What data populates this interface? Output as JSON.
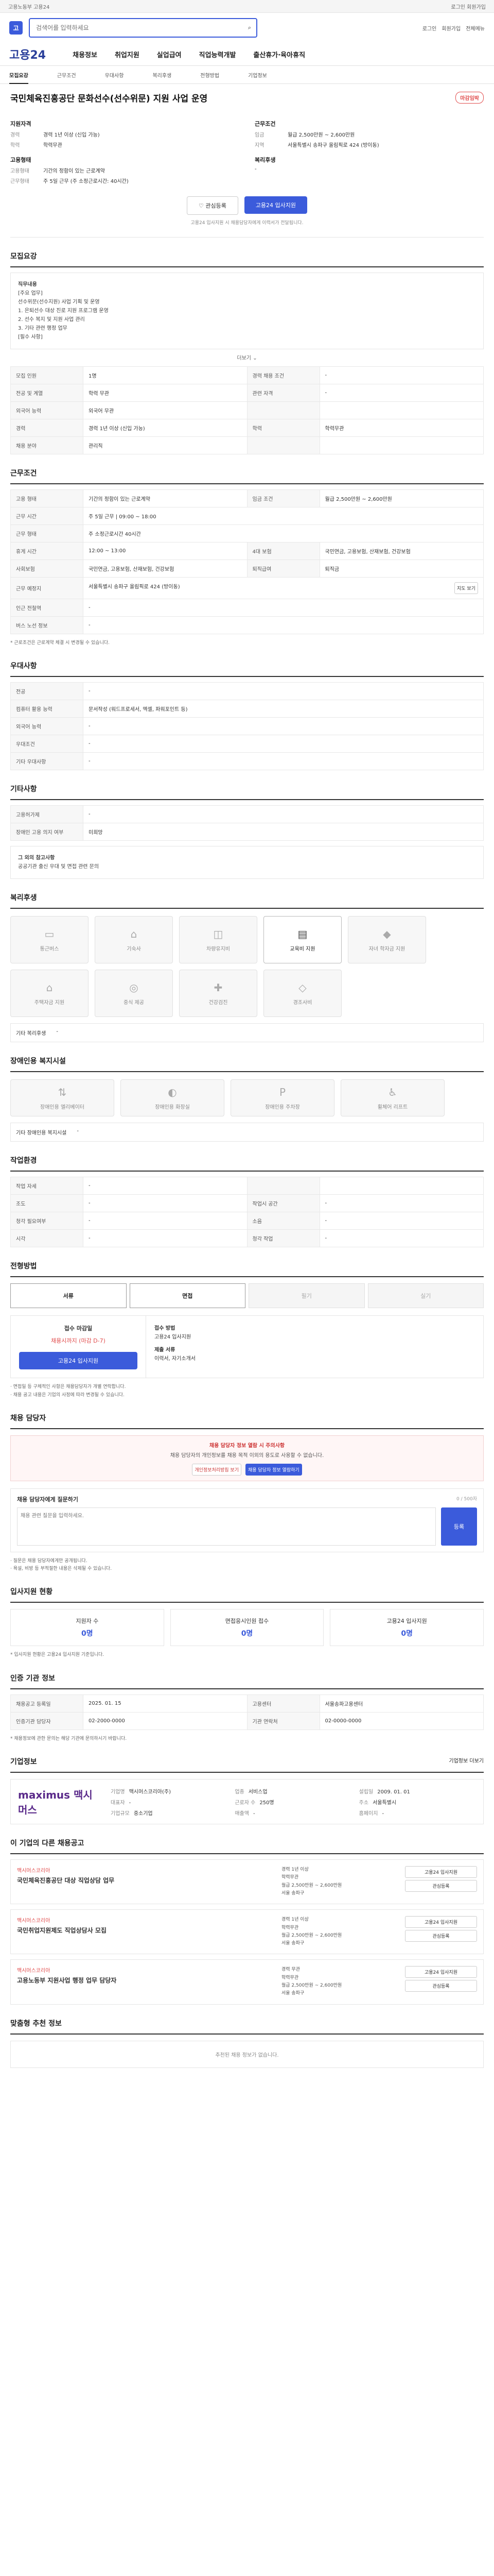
{
  "topbar": {
    "left": "고용노동부 고용24",
    "right": "로그인 회원가입"
  },
  "header": {
    "logo": "고",
    "search_placeholder": "검색어를 입력하세요",
    "util": [
      "로그인",
      "회원가입",
      "전체메뉴"
    ]
  },
  "brand": {
    "name": "고용24",
    "menu": [
      "채용정보",
      "취업지원",
      "실업급여",
      "직업능력개발",
      "출산휴가·육아휴직"
    ]
  },
  "subnav": [
    "모집요강",
    "근무조건",
    "우대사항",
    "복리후생",
    "전형방법",
    "기업정보"
  ],
  "job": {
    "title": "국민체육진흥공단 문화선수(선수위문) 지원 사업 운영",
    "badge": "마감임박",
    "left_head": "지원자격",
    "left": [
      {
        "k": "경력",
        "v": "경력 1년 이상 (신입 가능)"
      },
      {
        "k": "학력",
        "v": "학력무관"
      }
    ],
    "right_head": "근무조건",
    "right": [
      {
        "k": "임금",
        "v": "월급 2,500만원 ~ 2,600만원"
      },
      {
        "k": "지역",
        "v": "서울특별시 송파구 올림픽로 424 (방이동)"
      }
    ],
    "emp_head": "고용형태",
    "emp": [
      {
        "k": "고용형태",
        "v": "기간의 정함이 있는 근로계약"
      },
      {
        "k": "근무형태",
        "v": "주 5일 근무 (주 소정근로시간: 40시간)"
      }
    ],
    "welfare_head": "복리후생",
    "welfare": "-"
  },
  "actions": {
    "interest": "관심등록",
    "apply": "고용24 입사지원",
    "note": "고용24 입사지원 시 채용담당자에게 이력서가 전달됩니다."
  },
  "recruit": {
    "title": "모집요강",
    "box_title": "직무내용",
    "box_lines": [
      "[주요 업무]",
      "선수위문(선수지원) 사업 기획 및 운영",
      "1. 은퇴선수 대상 진로 지원 프로그램 운영",
      "2. 선수 복지 및 지원 사업 관리",
      "3. 기타 관련 행정 업무",
      "[필수 사항]"
    ],
    "expand": "더보기",
    "rows": [
      {
        "k": "모집 인원",
        "v": "1명",
        "k2": "경력 채용 조건",
        "v2": "-"
      },
      {
        "k": "전공 및 계열",
        "v": "학력 무관",
        "k2": "관련 자격",
        "v2": "-"
      },
      {
        "k": "외국어 능력",
        "v": "외국어 무관",
        "k2": "",
        "v2": ""
      },
      {
        "k": "경력",
        "v": "경력 1년 이상 (신입 가능)",
        "k2": "학력",
        "v2": "학력무관"
      },
      {
        "k": "채용 분야",
        "v": "관리직",
        "k2": "",
        "v2": ""
      }
    ]
  },
  "work": {
    "title": "근무조건",
    "rows": [
      {
        "k": "고용 형태",
        "v": "기간의 정함이 있는 근로계약",
        "k2": "임금 조건",
        "v2": "월급 2,500만원 ~ 2,600만원"
      },
      {
        "k": "근무 시간",
        "v": "주 5일 근무 | 09:00 ~ 18:00",
        "k2": "",
        "v2": ""
      },
      {
        "k": "근무 형태",
        "v": "주 소정근로시간 40시간",
        "k2": "",
        "v2": ""
      },
      {
        "k": "휴게 시간",
        "v": "12:00 ~ 13:00",
        "k2": "4대 보험",
        "v2": "국민연금, 고용보험, 산재보험, 건강보험"
      },
      {
        "k": "사회보험",
        "v": "국민연금, 고용보험, 산재보험, 건강보험",
        "k2": "퇴직급여",
        "v2": "퇴직금"
      },
      {
        "k": "근무 예정지",
        "v": "서울특별시 송파구 올림픽로 424 (방이동)",
        "k2": "",
        "v2": ""
      },
      {
        "k": "인근 전철역",
        "v": "-",
        "k2": "",
        "v2": ""
      },
      {
        "k": "버스 노선 정보",
        "v": "-",
        "k2": "",
        "v2": ""
      }
    ],
    "note": "* 근로조건은 근로계약 체결 시 변경될 수 있습니다."
  },
  "pref": {
    "title": "우대사항",
    "rows": [
      {
        "k": "전공",
        "v": "-"
      },
      {
        "k": "컴퓨터 활용 능력",
        "v": "문서작성 (워드프로세서, 엑셀, 파워포인트 등)"
      },
      {
        "k": "외국어 능력",
        "v": "-"
      },
      {
        "k": "우대조건",
        "v": "-"
      },
      {
        "k": "기타 우대사항",
        "v": "-"
      }
    ]
  },
  "other": {
    "title": "기타사항",
    "rows": [
      {
        "k": "고용허가제",
        "v": "-"
      },
      {
        "k": "장애인 고용 의지 여부",
        "v": "미희망"
      }
    ],
    "note_title": "그 외의 참고사항",
    "note_text": "공공기관 출신 우대 및 면접 관련 문의"
  },
  "welfare": {
    "title": "복리후생",
    "tiles": [
      {
        "label": "통근버스",
        "on": false
      },
      {
        "label": "기숙사",
        "on": false
      },
      {
        "label": "차량유지비",
        "on": false
      },
      {
        "label": "교육비 지원",
        "on": true
      },
      {
        "label": "자녀 학자금 지원",
        "on": false
      },
      {
        "label": "주택자금 지원",
        "on": false
      },
      {
        "label": "중식 제공",
        "on": false
      },
      {
        "label": "건강검진",
        "on": false
      },
      {
        "label": "경조사비",
        "on": false
      }
    ],
    "etc_label": "기타 복리후생",
    "etc_value": "-"
  },
  "disabled_fac": {
    "title": "장애인용 복지시설",
    "tiles": [
      {
        "label": "장애인용 엘리베이터"
      },
      {
        "label": "장애인용 화장실"
      },
      {
        "label": "장애인용 주차장"
      },
      {
        "label": "휠체어 리프트"
      }
    ],
    "etc_label": "기타 장애인용 복지시설",
    "etc_value": "-"
  },
  "workplace": {
    "title": "작업환경",
    "rows": [
      {
        "k": "작업 자세",
        "v": "-",
        "k2": "",
        "v2": ""
      },
      {
        "k": "조도",
        "v": "-",
        "k2": "작업시 공간",
        "v2": "-"
      },
      {
        "k": "청각 필요여부",
        "v": "-",
        "k2": "소음",
        "v2": "-"
      },
      {
        "k": "시각",
        "v": "-",
        "k2": "청각 작업",
        "v2": "-"
      }
    ]
  },
  "process": {
    "title": "전형방법",
    "steps": [
      {
        "label": "서류",
        "on": true
      },
      {
        "label": "면접",
        "on": true
      },
      {
        "label": "필기",
        "on": false
      },
      {
        "label": "실기",
        "on": false
      }
    ],
    "deadline_label": "접수 마감일",
    "deadline_value": "채용시까지 (마감 D-7)",
    "method_label": "접수 방법",
    "method_value": "고용24 입사지원",
    "docs_label": "제출 서류",
    "docs_value": "이력서, 자기소개서",
    "apply_btn": "고용24 입사지원",
    "bullets": [
      "· 면접일 등 구체적인 사항은 채용담당자가 개별 연락합니다.",
      "· 채용 공고 내용은 기업의 사정에 따라 변경될 수 있습니다."
    ]
  },
  "contact": {
    "title": "채용 담당자",
    "warn": "채용 담당자 정보 열람 시 주의사항",
    "warn_text": "채용 담당자의 개인정보를 채용 목적 이외의 용도로 사용할 수 없습니다.",
    "btn1": "개인정보처리방침 보기",
    "btn2": "채용 담당자 정보 열람하기"
  },
  "qa": {
    "title": "채용 담당자에게 질문하기",
    "counter": "0 / 500자",
    "placeholder": "채용 관련 질문을 입력하세요.",
    "submit": "등록",
    "bullets": [
      "· 질문은 채용 담당자에게만 공개됩니다.",
      "· 욕설, 비방 등 부적절한 내용은 삭제될 수 있습니다."
    ]
  },
  "status": {
    "title": "입사지원 현황",
    "cards": [
      {
        "label": "지원자 수",
        "value": "0명"
      },
      {
        "label": "면접응시인원 접수",
        "value": "0명"
      },
      {
        "label": "고용24 입사지원",
        "value": "0명"
      }
    ],
    "note": "* 입사지원 현황은 고용24 입사지원 기준입니다."
  },
  "reg": {
    "title": "인증 기관 정보",
    "rows": [
      {
        "k": "채용공고 등록일",
        "v": "2025. 01. 15",
        "k2": "고용센터",
        "v2": "서울송파고용센터"
      },
      {
        "k": "인증기관 담당자",
        "v": "02-2000-0000",
        "k2": "기관 연락처",
        "v2": "02-0000-0000"
      }
    ],
    "note": "* 채용정보에 관한 문의는 해당 기관에 문의하시기 바랍니다."
  },
  "company": {
    "title": "기업정보",
    "more": "기업정보 더보기",
    "logo": "maximus 맥시머스",
    "fields": [
      {
        "k": "기업명",
        "v": "맥시머스코리아(주)"
      },
      {
        "k": "업종",
        "v": "서비스업"
      },
      {
        "k": "설립일",
        "v": "2009. 01. 01"
      },
      {
        "k": "대표자",
        "v": "-"
      },
      {
        "k": "근로자 수",
        "v": "250명"
      },
      {
        "k": "주소",
        "v": "서울특별시"
      },
      {
        "k": "기업규모",
        "v": "중소기업"
      },
      {
        "k": "매출액",
        "v": "-"
      },
      {
        "k": "홈페이지",
        "v": "-"
      }
    ]
  },
  "other_jobs": {
    "title": "이 기업의 다른 채용공고",
    "items": [
      {
        "org": "맥시머스코리아",
        "title": "국민체육진흥공단 대상 직업상담 업무",
        "meta": [
          "경력 1년 이상",
          "학력무관",
          "월급 2,500만원 ~ 2,600만원",
          "서울 송파구"
        ],
        "btn1": "고용24 입사지원",
        "btn2": "관심등록"
      },
      {
        "org": "맥시머스코리아",
        "title": "국민취업지원제도 직업상담사 모집",
        "meta": [
          "경력 1년 이상",
          "학력무관",
          "월급 2,500만원 ~ 2,600만원",
          "서울 송파구"
        ],
        "btn1": "고용24 입사지원",
        "btn2": "관심등록"
      },
      {
        "org": "맥시머스코리아",
        "title": "고용노동부 지원사업 행정 업무 담당자",
        "meta": [
          "경력 무관",
          "학력무관",
          "월급 2,500만원 ~ 2,600만원",
          "서울 송파구"
        ],
        "btn1": "고용24 입사지원",
        "btn2": "관심등록"
      }
    ]
  },
  "recommend": {
    "title": "맞춤형 추천 정보",
    "empty": "추천된 채용 정보가 없습니다."
  }
}
